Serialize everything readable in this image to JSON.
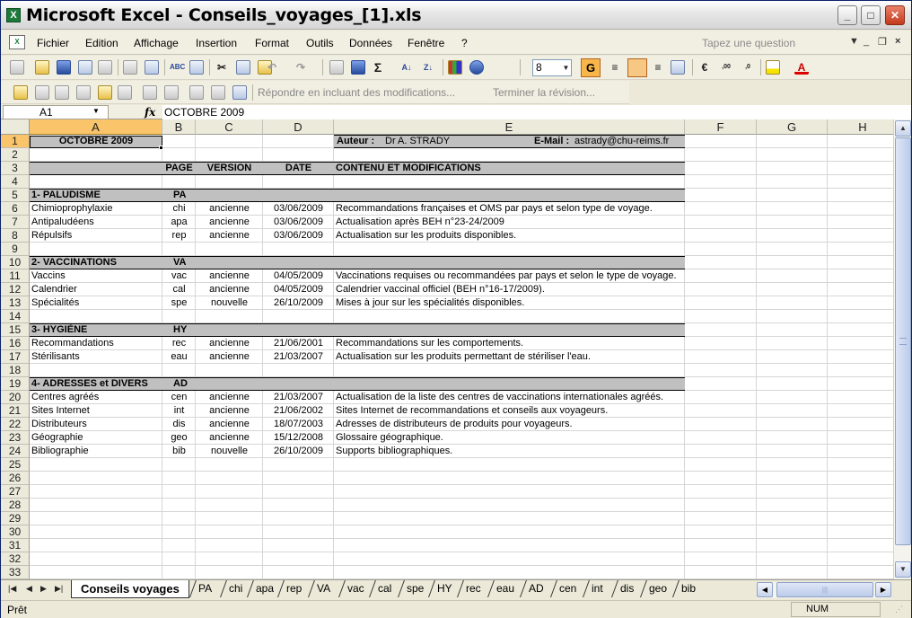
{
  "window": {
    "title": "Microsoft Excel - Conseils_voyages_[1].xls"
  },
  "menu": {
    "items": [
      "Fichier",
      "Edition",
      "Affichage",
      "Insertion",
      "Format",
      "Outils",
      "Données",
      "Fenêtre",
      "?"
    ],
    "ask_placeholder": "Tapez une question"
  },
  "toolbar": {
    "font_size": "8",
    "bold_label": "G",
    "reviewing": {
      "reply": "Répondre en incluant des modifications...",
      "end": "Terminer la révision..."
    }
  },
  "formula_bar": {
    "name_box": "A1",
    "fx": "fx",
    "value": "OCTOBRE 2009"
  },
  "sheet": {
    "columns": [
      "A",
      "B",
      "C",
      "D",
      "E",
      "F",
      "G",
      "H"
    ],
    "rows": [
      "1",
      "2",
      "3",
      "4",
      "5",
      "6",
      "7",
      "8",
      "9",
      "10",
      "11",
      "12",
      "13",
      "14",
      "15",
      "16",
      "17",
      "18",
      "19",
      "20",
      "21",
      "22",
      "23",
      "24",
      "25",
      "26",
      "27",
      "28",
      "29",
      "30",
      "31",
      "32",
      "33"
    ],
    "a1": "OCTOBRE 2009",
    "author_label": "Auteur :",
    "author": "Dr A. STRADY",
    "email_label": "E-Mail :",
    "email": "astrady@chu-reims.fr",
    "headers": {
      "page": "PAGE",
      "version": "VERSION",
      "date": "DATE",
      "content": "CONTENU ET MODIFICATIONS"
    },
    "sections": [
      {
        "row": 5,
        "name": "1- PALUDISME",
        "code": "PA"
      },
      {
        "row": 10,
        "name": "2- VACCINATIONS",
        "code": "VA"
      },
      {
        "row": 15,
        "name": "3- HYGIÈNE",
        "code": "HY"
      },
      {
        "row": 19,
        "name": "4- ADRESSES et DIVERS",
        "code": "AD"
      }
    ],
    "entries": [
      {
        "row": 6,
        "name": "Chimioprophylaxie",
        "page": "chi",
        "version": "ancienne",
        "date": "03/06/2009",
        "content": "Recommandations françaises et OMS par pays et selon type de voyage."
      },
      {
        "row": 7,
        "name": "Antipaludéens",
        "page": "apa",
        "version": "ancienne",
        "date": "03/06/2009",
        "content": "Actualisation après BEH n°23-24/2009"
      },
      {
        "row": 8,
        "name": "Répulsifs",
        "page": "rep",
        "version": "ancienne",
        "date": "03/06/2009",
        "content": "Actualisation sur les produits disponibles."
      },
      {
        "row": 11,
        "name": "Vaccins",
        "page": "vac",
        "version": "ancienne",
        "date": "04/05/2009",
        "content": "Vaccinations requises ou recommandées par pays et selon le type de voyage."
      },
      {
        "row": 12,
        "name": "Calendrier",
        "page": "cal",
        "version": "ancienne",
        "date": "04/05/2009",
        "content": "Calendrier vaccinal officiel (BEH n°16-17/2009)."
      },
      {
        "row": 13,
        "name": "Spécialités",
        "page": "spe",
        "version": "nouvelle",
        "date": "26/10/2009",
        "content": "Mises à jour sur les spécialités disponibles."
      },
      {
        "row": 16,
        "name": "Recommandations",
        "page": "rec",
        "version": "ancienne",
        "date": "21/06/2001",
        "content": "Recommandations sur les comportements."
      },
      {
        "row": 17,
        "name": "Stérilisants",
        "page": "eau",
        "version": "ancienne",
        "date": "21/03/2007",
        "content": "Actualisation sur les produits permettant de stériliser l'eau."
      },
      {
        "row": 20,
        "name": "Centres agréés",
        "page": "cen",
        "version": "ancienne",
        "date": "21/03/2007",
        "content": "Actualisation de la liste des centres de vaccinations internationales agréés."
      },
      {
        "row": 21,
        "name": "Sites Internet",
        "page": "int",
        "version": "ancienne",
        "date": "21/06/2002",
        "content": "Sites Internet de recommandations et conseils aux voyageurs."
      },
      {
        "row": 22,
        "name": "Distributeurs",
        "page": "dis",
        "version": "ancienne",
        "date": "18/07/2003",
        "content": "Adresses de distributeurs de produits pour voyageurs."
      },
      {
        "row": 23,
        "name": "Géographie",
        "page": "geo",
        "version": "ancienne",
        "date": "15/12/2008",
        "content": "Glossaire géographique."
      },
      {
        "row": 24,
        "name": "Bibliographie",
        "page": "bib",
        "version": "nouvelle",
        "date": "26/10/2009",
        "content": "Supports bibliographiques."
      }
    ]
  },
  "tabs": {
    "active": "Conseils voyages",
    "others": [
      "PA",
      "chi",
      "apa",
      "rep",
      "VA",
      "vac",
      "cal",
      "spe",
      "HY",
      "rec",
      "eau",
      "AD",
      "cen",
      "int",
      "dis",
      "geo",
      "bib"
    ]
  },
  "status": {
    "text": "Prêt",
    "num": "NUM"
  }
}
